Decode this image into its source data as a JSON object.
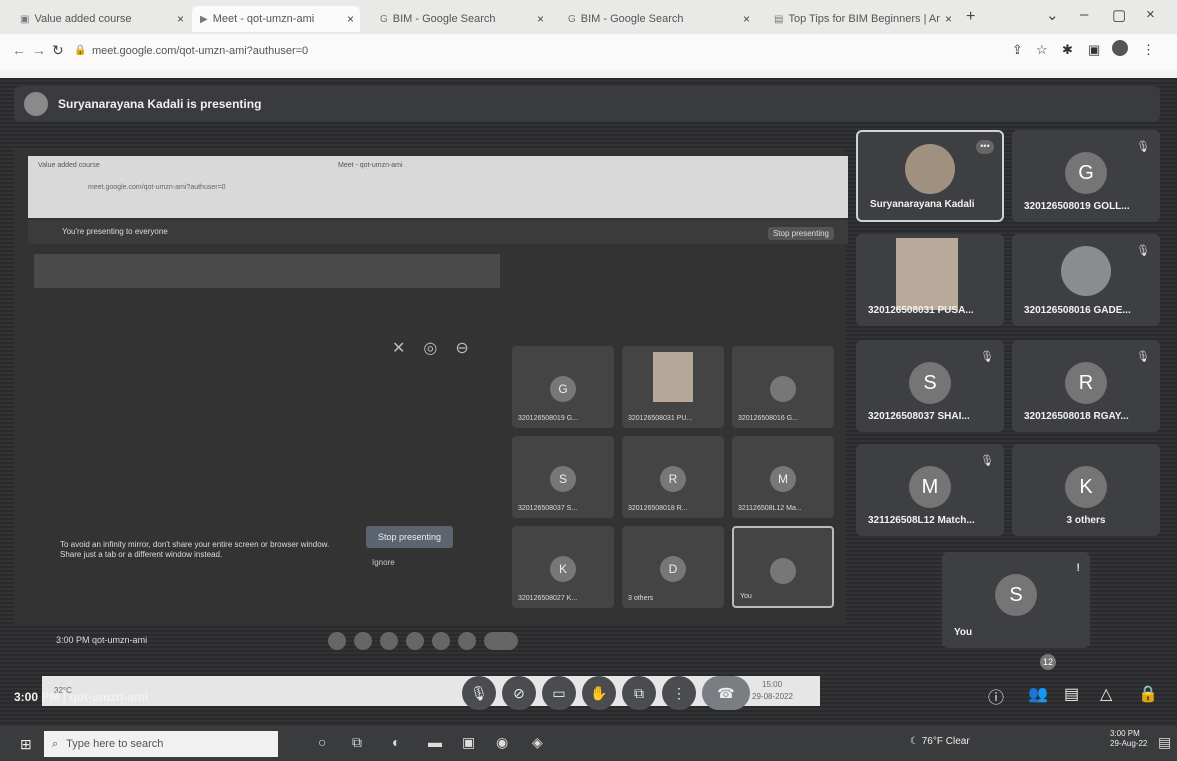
{
  "browser": {
    "tabs": [
      {
        "label": "Value added course"
      },
      {
        "label": "Meet - qot-umzn-ami"
      },
      {
        "label": "BIM - Google Search"
      },
      {
        "label": "BIM - Google Search"
      },
      {
        "label": "Top Tips for BIM Beginners | Ar"
      }
    ],
    "new_tab": "+",
    "url": "meet.google.com/qot-umzn-ami?authuser=0"
  },
  "meet": {
    "presenting_banner": "Suryanarayana Kadali is presenting",
    "meeting_time": "3:00 PM",
    "meeting_code": "qot-umzn-ami",
    "people_count": "12",
    "participants": [
      {
        "label": "Suryanarayana Kadali"
      },
      {
        "label": "320126508019 GOLL..."
      },
      {
        "label": "320126508031 PUSA..."
      },
      {
        "label": "320126508016 GADE..."
      },
      {
        "label": "320126508037 SHAI..."
      },
      {
        "label": "320126508018 RGAY..."
      },
      {
        "label": "321126508L12 Match..."
      },
      {
        "label": "3 others"
      },
      {
        "label": "You"
      }
    ],
    "avatar_letters": [
      "G",
      "S",
      "R",
      "M",
      "K",
      "S"
    ]
  },
  "shared_screen": {
    "presenting_to_everyone": "You're presenting to everyone",
    "stop_presenting_small": "Stop presenting",
    "infinity_warning": "To avoid an infinity mirror, don't share your entire screen or browser window. Share just a tab or a different window instead.",
    "stop_presenting_button": "Stop presenting",
    "ignore": "Ignore",
    "mini_tiles": [
      {
        "letter": "G",
        "label": "320126508019 G..."
      },
      {
        "letter": "",
        "label": "320126508031 PU..."
      },
      {
        "letter": "",
        "label": "320126508016 G..."
      },
      {
        "letter": "S",
        "label": "320126508037 S..."
      },
      {
        "letter": "R",
        "label": "320126508018 R..."
      },
      {
        "letter": "M",
        "label": "321126508L12 Ma..."
      },
      {
        "letter": "K",
        "label": "320126508027 K..."
      },
      {
        "letter": "D",
        "label": "3 others"
      },
      {
        "letter": "",
        "label": "You"
      }
    ],
    "mini_time": "3:00 PM",
    "mini_code": "qot-umzn-ami",
    "mini_weather": "32°C",
    "mini_clock_time": "15:00",
    "mini_clock_date": "29-08-2022"
  },
  "taskbar": {
    "search_placeholder": "Type here to search",
    "weather": "76°F Clear",
    "clock_time": "3:00 PM",
    "clock_date": "29-Aug-22"
  }
}
